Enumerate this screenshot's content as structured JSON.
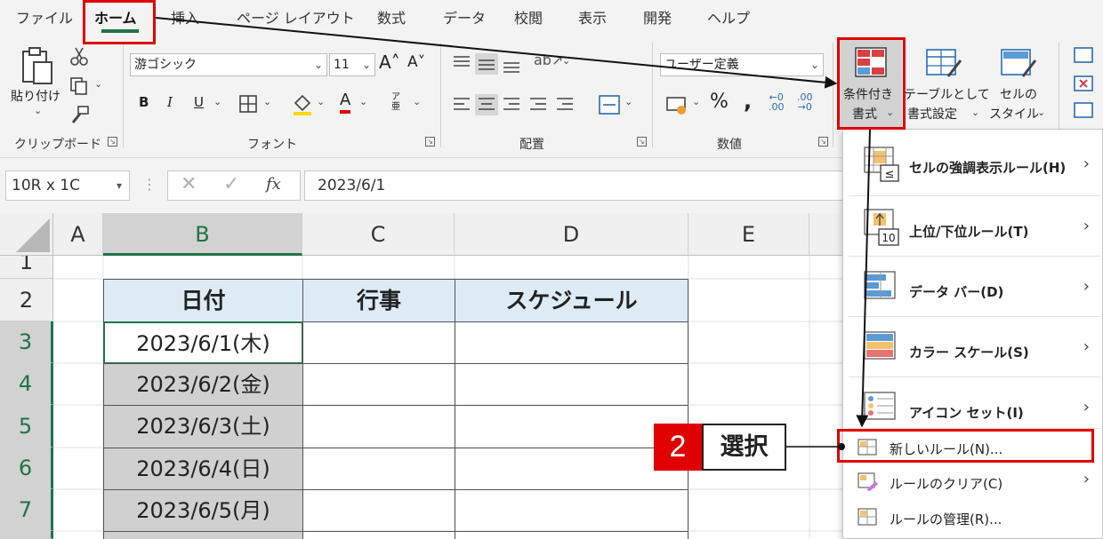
{
  "tabs": [
    {
      "label": "ファイル",
      "active": false
    },
    {
      "label": "ホーム",
      "active": true
    },
    {
      "label": "挿入",
      "active": false
    },
    {
      "label": "ページ レイアウト",
      "active": false
    },
    {
      "label": "数式",
      "active": false
    },
    {
      "label": "データ",
      "active": false
    },
    {
      "label": "校閲",
      "active": false
    },
    {
      "label": "表示",
      "active": false
    },
    {
      "label": "開発",
      "active": false
    },
    {
      "label": "ヘルプ",
      "active": false
    }
  ],
  "ribbon": {
    "clipboard": {
      "label": "クリップボード",
      "paste": "貼り付け"
    },
    "font": {
      "label": "フォント",
      "name": "游ゴシック",
      "size": "11"
    },
    "alignment": {
      "label": "配置"
    },
    "number": {
      "label": "数値",
      "format": "ユーザー定義"
    },
    "styles": {
      "conditional_line1": "条件付き",
      "conditional_line2": "書式",
      "table_line1": "テーブルとして",
      "table_line2": "書式設定",
      "cell_line1": "セルの",
      "cell_line2": "スタイル"
    }
  },
  "formula_bar": {
    "name_box": "10R x 1C",
    "fx": "fx",
    "value": "2023/6/1"
  },
  "grid": {
    "columns": [
      "A",
      "B",
      "C",
      "D",
      "E"
    ],
    "rows": [
      "1",
      "2",
      "3",
      "4",
      "5",
      "6",
      "7"
    ],
    "headers": [
      "日付",
      "行事",
      "スケジュール"
    ],
    "dates": [
      "2023/6/1(木)",
      "2023/6/2(金)",
      "2023/6/3(土)",
      "2023/6/4(日)",
      "2023/6/5(月)"
    ]
  },
  "menu": {
    "items": [
      {
        "label": "セルの強調表示ルール(H)",
        "submenu": true
      },
      {
        "label": "上位/下位ルール(T)",
        "submenu": true
      },
      {
        "label": "データ バー(D)",
        "submenu": true
      },
      {
        "label": "カラー スケール(S)",
        "submenu": true
      },
      {
        "label": "アイコン セット(I)",
        "submenu": true
      },
      {
        "label": "新しいルール(N)...",
        "submenu": false
      },
      {
        "label": "ルールのクリア(C)",
        "submenu": true
      },
      {
        "label": "ルールの管理(R)...",
        "submenu": false
      }
    ],
    "icon_value": "10"
  },
  "annotation": {
    "step": "2",
    "label": "選択"
  },
  "colors": {
    "accent_green": "#217346",
    "highlight_red": "#e00000",
    "header_fill": "#ddebf7"
  }
}
